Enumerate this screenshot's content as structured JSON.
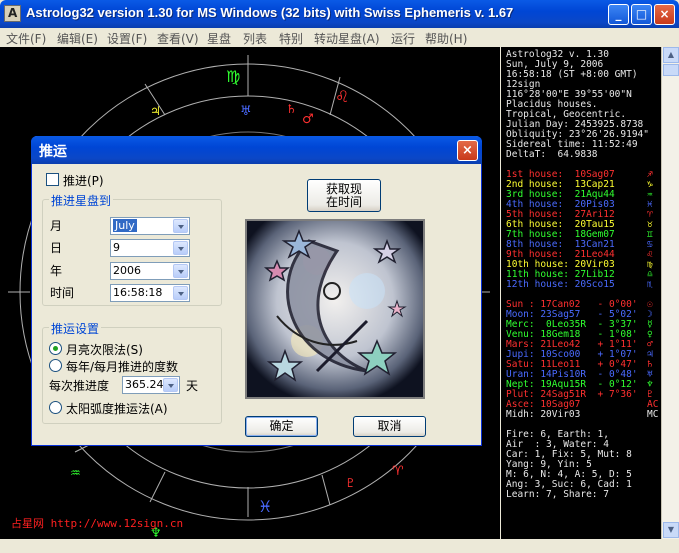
{
  "window": {
    "title": "Astrolog32 version 1.30 for MS Windows (32 bits) with Swiss Ephemeris v. 1.67",
    "minimize": "_",
    "maximize": "□",
    "close": "×"
  },
  "menu": [
    "文件(F)",
    "编辑(E)",
    "设置(F)",
    "查看(V)",
    "星盘",
    "列表",
    "特别",
    "转动星盘(A)",
    "运行",
    "帮助(H)"
  ],
  "site": "占星网 http://www.12sign.cn",
  "info": {
    "header": [
      "Astrolog32 v. 1.30",
      "Sun, July 9, 2006",
      "16:58:18 (ST +8:00 GMT)",
      "12sign",
      "116°28'00\"E 39°55'00\"N",
      "Placidus houses.",
      "Tropical, Geocentric.",
      "Julian Day: 2453925.8738",
      "Obliquity: 23°26'26.9194\"",
      "Sidereal time: 11:52:49",
      "DeltaT:  64.9838"
    ],
    "houses": [
      {
        "text": "1st house:  10Sag07",
        "color": "#ff3030",
        "sym": "♐"
      },
      {
        "text": "2nd house:  13Cap21",
        "color": "#ffff30",
        "sym": "♑"
      },
      {
        "text": "3rd house:  21Aqu44",
        "color": "#30ff30",
        "sym": "♒"
      },
      {
        "text": "4th house:  20Pis03",
        "color": "#4a6aff",
        "sym": "♓"
      },
      {
        "text": "5th house:  27Ari12",
        "color": "#ff3030",
        "sym": "♈"
      },
      {
        "text": "6th house:  20Tau15",
        "color": "#ffff30",
        "sym": "♉"
      },
      {
        "text": "7th house:  18Gem07",
        "color": "#30ff30",
        "sym": "♊"
      },
      {
        "text": "8th house:  13Can21",
        "color": "#4a6aff",
        "sym": "♋"
      },
      {
        "text": "9th house:  21Leo44",
        "color": "#ff3030",
        "sym": "♌"
      },
      {
        "text": "10th house: 20Vir03",
        "color": "#ffff30",
        "sym": "♍"
      },
      {
        "text": "11th house: 27Lib12",
        "color": "#30ff30",
        "sym": "♎"
      },
      {
        "text": "12th house: 20Sco15",
        "color": "#4a6aff",
        "sym": "♏"
      }
    ],
    "planets": [
      {
        "text": "Sun : 17Can02   - 0°00'",
        "color": "#ff3030",
        "sym": "☉"
      },
      {
        "text": "Moon: 23Sag57   - 5°02'",
        "color": "#4a6aff",
        "sym": "☽"
      },
      {
        "text": "Merc:  0Leo35R  - 3°37'",
        "color": "#30ff30",
        "sym": "☿"
      },
      {
        "text": "Venu: 18Gem18   - 1°08'",
        "color": "#30ff30",
        "sym": "♀"
      },
      {
        "text": "Mars: 21Leo42   + 1°11'",
        "color": "#ff3030",
        "sym": "♂"
      },
      {
        "text": "Jupi: 10Sco00   + 1°07'",
        "color": "#4a6aff",
        "sym": "♃"
      },
      {
        "text": "Satu: 11Leo11   + 0°47'",
        "color": "#ff3030",
        "sym": "♄"
      },
      {
        "text": "Uran: 14Pis10R  - 0°48'",
        "color": "#4a6aff",
        "sym": "♅"
      },
      {
        "text": "Nept: 19Aqu15R  - 0°12'",
        "color": "#30ff30",
        "sym": "♆"
      },
      {
        "text": "Plut: 24Sag51R  + 7°36'",
        "color": "#ff3030",
        "sym": "♇"
      },
      {
        "text": "Asce: 10Sag07",
        "color": "#ff3030",
        "sym": "AC"
      },
      {
        "text": "Midh: 20Vir03",
        "color": "#e8e8e8",
        "sym": "MC"
      }
    ],
    "elements": [
      "Fire: 6, Earth: 1,",
      "Air  : 3, Water: 4",
      "Car: 1, Fix: 5, Mut: 8",
      "Yang: 9, Yin: 5",
      "M: 6, N: 4, A: 5, D: 5",
      "Ang: 3, Suc: 6, Cad: 1",
      "Learn: 7, Share: 7"
    ]
  },
  "dialog": {
    "title": "推运",
    "close": "×",
    "progress_label": "推进(P)",
    "progress_checked": false,
    "fetch_button": "获取现\n在时间",
    "group1_title": "推进星盘到",
    "month_label": "月",
    "month_value": "July",
    "day_label": "日",
    "day_value": "9",
    "year_label": "年",
    "year_value": "2006",
    "time_label": "时间",
    "time_value": "16:58:18",
    "group2_title": "推运设置",
    "radio1": "月亮次限法(S)",
    "radio2": "每年/每月推进的度数",
    "rate_label": "每次推进度",
    "rate_value": "365.2422",
    "rate_unit": "天",
    "radio3": "太阳弧度推运法(A)",
    "ok": "确定",
    "cancel": "取消"
  },
  "colors": {
    "xp_blue": "#0046d5",
    "dialog_bg": "#ece9d8",
    "chart_bg": "#000000"
  }
}
